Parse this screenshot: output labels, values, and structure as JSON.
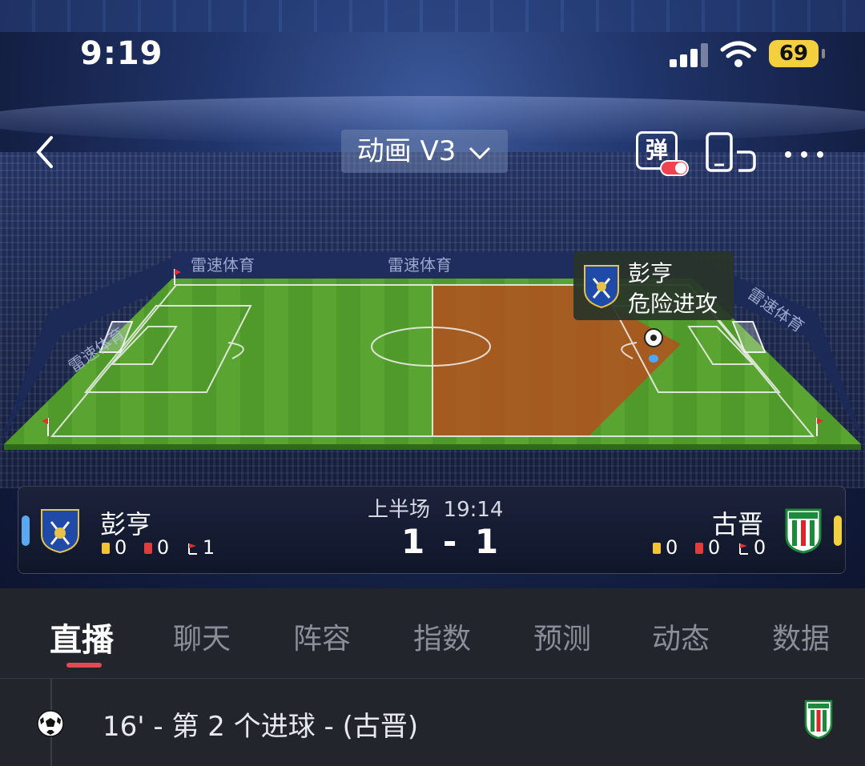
{
  "status_bar": {
    "time": "9:19",
    "battery": "69",
    "signal_icon": "signal-icon",
    "wifi_icon": "wifi-icon"
  },
  "nav": {
    "back_icon": "chevron-left-icon",
    "mode_label": "动画 V3",
    "mode_dropdown_icon": "chevron-down-icon",
    "danmaku_label": "弹",
    "rotate_icon": "rotate-screen-icon",
    "more_icon": "more-icon"
  },
  "pitch": {
    "adboard_text": "雷速体育",
    "attack_zone_color": "#b4501f",
    "grass_color": "#4f9a2a"
  },
  "event_popup": {
    "team": "彭亨",
    "description": "危险进攻"
  },
  "match": {
    "period": "上半场",
    "clock": "19:14",
    "score": "1 - 1",
    "home": {
      "name": "彭亨",
      "color": "#5aa8f0",
      "yellow_cards": "0",
      "red_cards": "0",
      "corners": "1"
    },
    "away": {
      "name": "古晋",
      "color": "#f4d03f",
      "yellow_cards": "0",
      "red_cards": "0",
      "corners": "0"
    }
  },
  "tabs": [
    {
      "label": "直播",
      "active": true
    },
    {
      "label": "聊天"
    },
    {
      "label": "阵容"
    },
    {
      "label": "指数"
    },
    {
      "label": "预测"
    },
    {
      "label": "动态"
    },
    {
      "label": "数据"
    }
  ],
  "feed": [
    {
      "icon": "soccer-ball-icon",
      "text": "16' - 第 2 个进球 - (古晋)"
    }
  ]
}
